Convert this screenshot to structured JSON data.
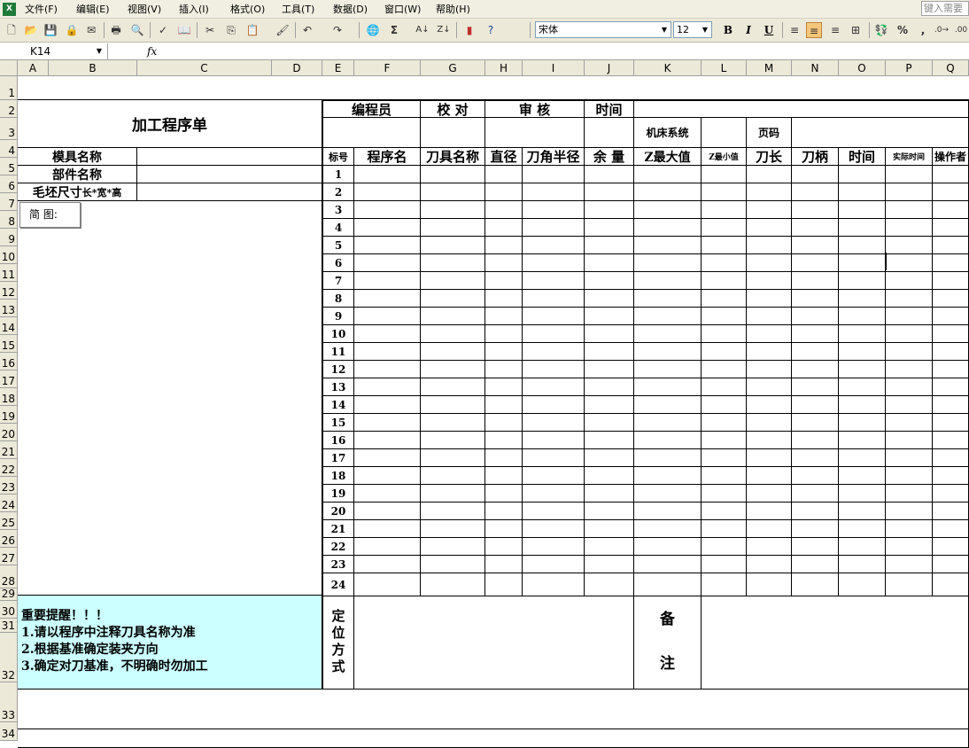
{
  "menubar": {
    "items": [
      "文件(F)",
      "编辑(E)",
      "视图(V)",
      "插入(I)",
      "格式(O)",
      "工具(T)",
      "数据(D)",
      "窗口(W)",
      "帮助(H)"
    ],
    "help_placeholder": "键入需要"
  },
  "toolbar": {
    "font_name": "宋体",
    "font_size": "12",
    "bold": "B",
    "italic": "I",
    "underline": "U",
    "sigma": "Σ",
    "percent": "%",
    "comma": ","
  },
  "formulabar": {
    "namebox": "K14",
    "fx": "fx",
    "value": ""
  },
  "columns": [
    "A",
    "B",
    "C",
    "D",
    "E",
    "F",
    "G",
    "H",
    "I",
    "J",
    "K",
    "L",
    "M",
    "N",
    "O",
    "P",
    "Q"
  ],
  "rows": [
    "1",
    "2",
    "3",
    "4",
    "5",
    "6",
    "7",
    "8",
    "9",
    "10",
    "11",
    "12",
    "13",
    "14",
    "15",
    "16",
    "17",
    "18",
    "19",
    "20",
    "21",
    "22",
    "23",
    "24",
    "25",
    "26",
    "27",
    "28",
    "29",
    "30",
    "31",
    "32",
    "33",
    "34"
  ],
  "sheet": {
    "title": "加工程序单",
    "header_row2": {
      "programmer": "编程员",
      "check": "校 对",
      "review": "审 核",
      "time": "时间"
    },
    "machine_system": "机床系统",
    "page_no": "页码",
    "mold_name": "模具名称",
    "part_name": "部件名称",
    "blank_size_main": "毛坯尺寸",
    "blank_size_sub": "长*宽*高",
    "sketch": "简  图:",
    "table_headers": [
      "标号",
      "程序名",
      "刀具名称",
      "直径",
      "刀角半径",
      "余 量",
      "Z最大值",
      "Z最小值",
      "刀长",
      "刀柄",
      "时间",
      "实际时间",
      "操作者"
    ],
    "numbers": [
      "1",
      "2",
      "3",
      "4",
      "5",
      "6",
      "7",
      "8",
      "9",
      "10",
      "11",
      "12",
      "13",
      "14",
      "15",
      "16",
      "17",
      "18",
      "19",
      "20",
      "21",
      "22",
      "23",
      "24"
    ],
    "reminder_title": "重要提醒！！！",
    "reminders": [
      "1.请以程序中注释刀具名称为准",
      "2.根据基准确定装夹方向",
      "3.确定对刀基准，不明确时勿加工"
    ],
    "positioning": [
      "定",
      "位",
      "方",
      "式"
    ],
    "remarks": [
      "备",
      "注"
    ]
  }
}
